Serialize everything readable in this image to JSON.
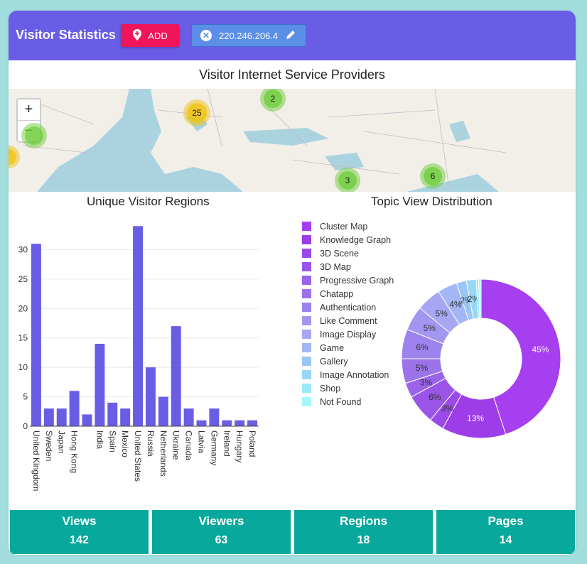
{
  "header": {
    "title": "Visitor Statistics",
    "add_label": "ADD",
    "ip_value": "220.246.206.4"
  },
  "map": {
    "title": "Visitor Internet Service Providers",
    "zoom_in": "+",
    "zoom_out": "−",
    "clusters": [
      "25",
      "2",
      "3",
      "6"
    ]
  },
  "bar_chart_title": "Unique Visitor Regions",
  "donut_chart_title": "Topic View Distribution",
  "chart_data": [
    {
      "type": "bar",
      "title": "Unique Visitor Regions",
      "categories": [
        "United Kingdom",
        "Sweden",
        "Japan",
        "Hong Kong",
        "",
        "India",
        "Spain",
        "Mexico",
        "United States",
        "Russia",
        "Netherlands",
        "Ukraine",
        "Canada",
        "Latvia",
        "Germany",
        "Ireland",
        "Hungary",
        "Poland"
      ],
      "values": [
        31,
        3,
        3,
        6,
        2,
        14,
        4,
        3,
        34,
        10,
        5,
        17,
        3,
        1,
        3,
        1,
        1,
        1
      ],
      "ylim": [
        0,
        35
      ],
      "yticks": [
        0,
        5,
        10,
        15,
        20,
        25,
        30
      ],
      "color": "#6a5de5",
      "grid": true
    },
    {
      "type": "pie",
      "title": "Topic View Distribution",
      "hole": true,
      "labels": [
        "Cluster Map",
        "Knowledge Graph",
        "3D Scene",
        "3D Map",
        "Progressive Graph",
        "Chatapp",
        "Authentication",
        "Like Comment",
        "Image Display",
        "Game",
        "Gallery",
        "Image Annotation",
        "Shop",
        "Not Found"
      ],
      "values": [
        45,
        13,
        3,
        6,
        3,
        5,
        6,
        5,
        5,
        4,
        2,
        2,
        0.5,
        0.5
      ],
      "display_labels": [
        "45%",
        "13%",
        "3%",
        "6%",
        "3%",
        "5%",
        "6%",
        "5%",
        "5%",
        "4%",
        "2%",
        "2%",
        "",
        ""
      ],
      "colors": [
        "#a53ff0",
        "#9d3de8",
        "#9a4ae8",
        "#9a55e8",
        "#9b63ea",
        "#9d73ec",
        "#9c83ee",
        "#a396f0",
        "#a6a6f2",
        "#a3b6f5",
        "#9ac6f6",
        "#97d8f7",
        "#97e8f8",
        "#a6f7fa"
      ],
      "legend_position": "left"
    }
  ],
  "stats": [
    {
      "label": "Views",
      "value": "142"
    },
    {
      "label": "Viewers",
      "value": "63"
    },
    {
      "label": "Regions",
      "value": "18"
    },
    {
      "label": "Pages",
      "value": "14"
    }
  ]
}
